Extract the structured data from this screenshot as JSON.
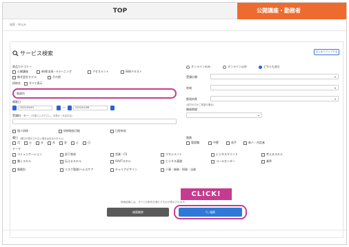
{
  "header": {
    "title": "TOP",
    "orange_tab": "公開講座・勤務者",
    "breadcrumb": "検索・申込み"
  },
  "main": {
    "heading": "サービス検索",
    "heading_icon": "search-icon",
    "options_button": "まとめてクリアする",
    "product_category_label": "商品カテゴリー",
    "categories": [
      "公開講座",
      "新規(出張・eラーニング",
      "アセスメント",
      "研修テキスト",
      "株式会社モデル",
      "その他"
    ],
    "online_radios": [
      {
        "label": "オンラインのみ",
        "selected": false
      },
      {
        "label": "オンライン以外",
        "selected": false
      },
      {
        "label": "どちらも含む",
        "selected": true
      }
    ],
    "genre_label": "受講分類",
    "region_label": "地域",
    "pref_label": "都道府県",
    "pref_note": "(地方の方がご希望の場合)",
    "duration_label": "開催期間",
    "target_label": "研修名",
    "target_sub": "すべて表示",
    "keyword_label": "フリーワード",
    "keyword_value": "階層別",
    "date_label": "開催日",
    "date_from": "2021/09/01",
    "date_sep": "〜",
    "date_to": "2022/01/06",
    "fee_label": "受講料・キー",
    "fee_note": "(半角で入力下さい。半角キーを区切る)",
    "flags": [
      "個人研修",
      "研修取扱可能",
      "日程有効"
    ],
    "weekday_label": "曜日",
    "weekday_note": "(曜日が表示されない場合は含まれません)",
    "weekdays": [
      "月",
      "火",
      "水",
      "木",
      "金",
      "土",
      "日"
    ],
    "level_label": "階層",
    "levels": [
      "管理職",
      "中堅",
      "若手",
      "新人・内定者"
    ],
    "theme_label": "テーマ",
    "themes": [
      "コミュニケーション",
      "部下育成",
      "営業・CS",
      "マネジメント",
      "ビジネスマインド",
      "考えるスキル",
      "書くスキル",
      "伝えるスキル",
      "OA/ITスキル",
      "ビジネス基礎",
      "コールセンター",
      "業界",
      "階層別",
      "リスク管理/ヘルスケア",
      "キャリアデザイン",
      "人事・総務・財務・法務"
    ],
    "notice": "検索結果には、すべての条件を満たすものが表示されます。",
    "clear_button": "検索解除",
    "search_button": "検索",
    "click_callout": "CLICK!"
  },
  "colors": {
    "accent_orange": "#ee6b2f",
    "highlight_pink": "#c63b8f",
    "primary_blue": "#2f79d8"
  }
}
